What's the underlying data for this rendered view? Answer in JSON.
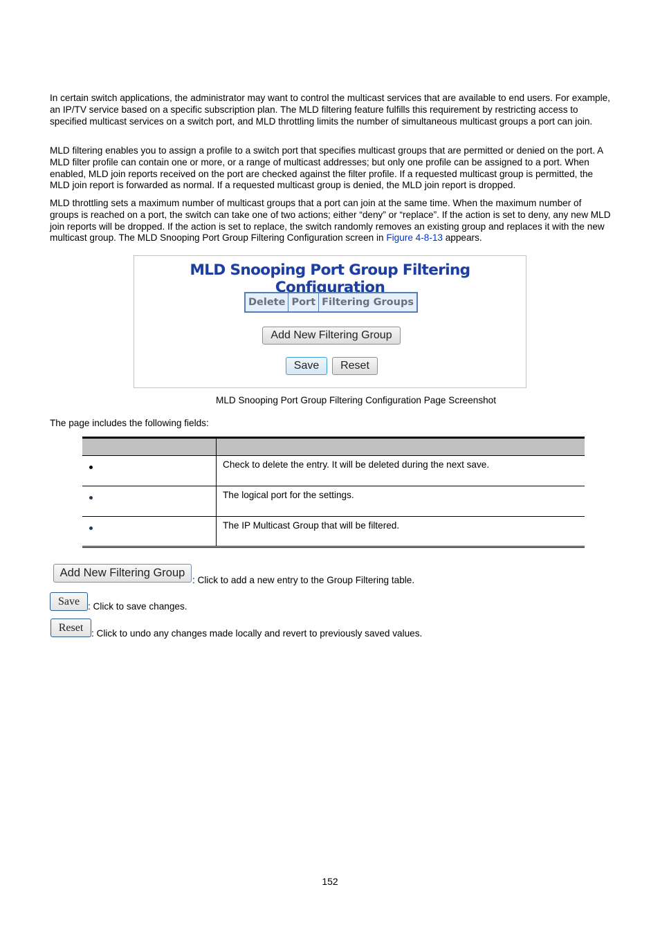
{
  "intro": {
    "paragraph1": "In certain switch applications, the administrator may want to control the multicast services that are available to end users. For example, an IP/TV service based on a specific subscription plan. The MLD filtering feature fulfills this requirement by restricting access to specified multicast services on a switch port, and MLD throttling limits the number of simultaneous multicast groups a port can join.",
    "paragraph2": "MLD filtering enables you to assign a profile to a switch port that specifies multicast groups that are permitted or denied on the port. A MLD filter profile can contain one or more, or a range of multicast addresses; but only one profile can be assigned to a port. When enabled, MLD join reports received on the port are checked against the filter profile. If a requested multicast group is permitted, the MLD join report is forwarded as normal. If a requested multicast group is denied, the MLD join report is dropped.",
    "paragraph3_before_link": "MLD throttling sets a maximum number of multicast groups that a port can join at the same time. When the maximum number of groups is reached on a port, the switch can take one of two actions; either “deny” or “replace”. If the action is set to deny, any new MLD join reports will be dropped. If the action is set to replace, the switch randomly removes an existing group and replaces it with the new multicast group. The MLD Snooping Port Group Filtering Configuration screen in ",
    "paragraph3_link": "Figure 4-8-13",
    "paragraph3_after_link": " appears."
  },
  "figure": {
    "title": "MLD Snooping Port Group Filtering Configuration",
    "table_headers": [
      "Delete",
      "Port",
      "Filtering Groups"
    ],
    "add_button": "Add New Filtering Group",
    "save_button": "Save",
    "reset_button": "Reset",
    "caption": "MLD Snooping Port Group Filtering Configuration Page Screenshot"
  },
  "fields": {
    "intro": "The page includes the following fields:",
    "header": [
      "",
      ""
    ],
    "rows": [
      {
        "object": "",
        "description": "Check to delete the entry. It will be deleted during the next save."
      },
      {
        "object": "",
        "description": "The logical port for the settings."
      },
      {
        "object": "",
        "description": "The IP Multicast Group that will be filtered."
      }
    ]
  },
  "buttons_desc": [
    {
      "label": "Add New Filtering Group",
      "text": ": Click to add a new entry to the Group Filtering table."
    },
    {
      "label": "Save",
      "text": ": Click to save changes."
    },
    {
      "label": "Reset",
      "text": ": Click to undo any changes made locally and revert to previously saved values."
    }
  ],
  "page_number": "152"
}
